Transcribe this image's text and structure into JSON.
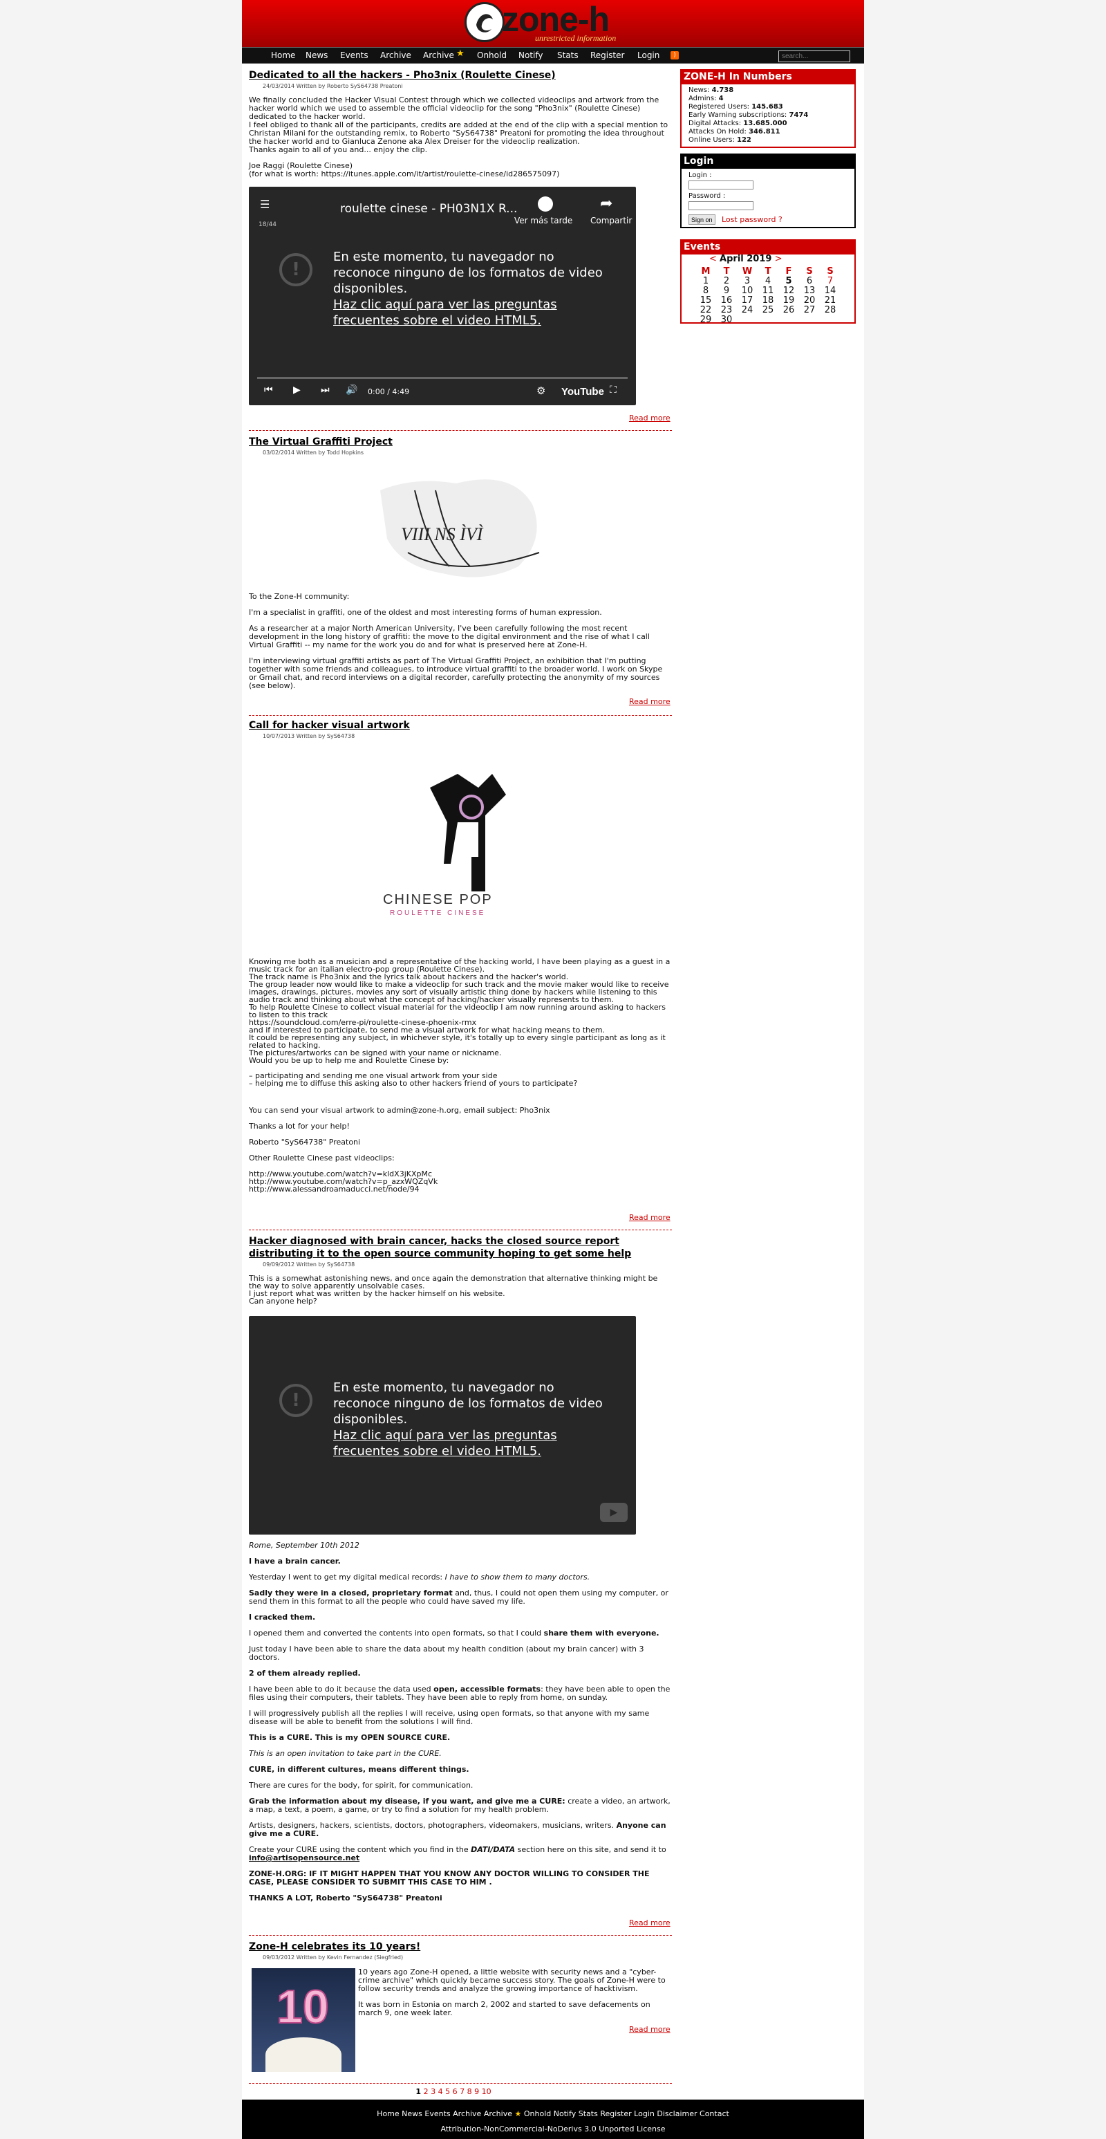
{
  "site": {
    "logo_text": "zone-h",
    "logo_subtitle": "unrestricted information"
  },
  "nav": [
    {
      "label": "Home"
    },
    {
      "label": "News"
    },
    {
      "label": "Events"
    },
    {
      "label": "Archive"
    },
    {
      "label": "Archive"
    },
    {
      "label": "Onhold"
    },
    {
      "label": "Notify"
    },
    {
      "label": "Stats"
    },
    {
      "label": "Register"
    },
    {
      "label": "Login"
    }
  ],
  "search": {
    "placeholder": "search..."
  },
  "articles": [
    {
      "title": "Dedicated to all the hackers - Pho3nix (Roulette Cinese)",
      "meta": "24/03/2014 Written by Roberto SyS64738 Preatoni",
      "p1": "We finally concluded the Hacker Visual Contest through which we collected videoclips and artwork from the hacker world which we used to assemble the official videoclip for the song \"Pho3nix\" (Roulette Cinese) dedicated to the hacker world.",
      "p2": "I feel obliged to thank all of the participants, credits are added at the end of the clip with a special mention to Christan Milani for the outstanding remix, to Roberto \"SyS64738\" Preatoni for promoting the idea throughout the hacker world and to Gianluca Zenone aka Alex Dreiser for the videoclip realization.",
      "p3": "Thanks again to all of you and... enjoy the clip.",
      "p4": "Joe Raggi (Roulette Cinese)",
      "p5": "(for what is worth: https://itunes.apple.com/it/artist/roulette-cinese/id286575097)",
      "video": {
        "title": "roulette cinese - PH03N1X R...",
        "counter": "18/44",
        "watch_later": "Ver más tarde",
        "share": "Compartir",
        "msg1": "En este momento, tu navegador no reconoce ninguno de los formatos de video disponibles.",
        "msg2": "Haz clic aquí para ver las preguntas frecuentes sobre el video HTML5.",
        "time": "0:00 / 4:49",
        "brand": "YouTube"
      }
    },
    {
      "title": "The Virtual Graffiti Project",
      "meta": "03/02/2014 Written by Todd Hopkins",
      "p1": "To the Zone-H community:",
      "p2": "I'm a specialist in graffiti, one of the oldest and most interesting forms of human expression.",
      "p3": "As a researcher at a major North American University, I've been carefully following the most recent development in the long history of graffiti: the move to the digital environment and the rise of what I call Virtual Graffiti -- my name for the work you do and for what is preserved here at Zone-H.",
      "p4": "I'm interviewing virtual graffiti artists as part of The Virtual Graffiti Project, an exhibition that I'm putting together with some friends and colleagues, to introduce virtual graffiti to the broader world. I work on Skype or Gmail chat, and record interviews on a digital recorder, carefully protecting the anonymity of my sources (see below).",
      "graffiti_text": "VIII NS ÌVÌ"
    },
    {
      "title": "Call for hacker visual artwork",
      "meta": "10/07/2013 Written by SyS64738",
      "logo_top": "CHINESE POP",
      "logo_bottom": "ROULETTE CINESE",
      "lines": [
        "Knowing me both as a musician and a representative of the hacking world, I have been playing as a guest in a music track for an italian electro-pop group (Roulette Cinese).",
        "The track name is Pho3nix and the lyrics talk about hackers and the hacker's world.",
        "The group leader now would like to make a videoclip for such track and the movie maker would like to receive images, drawings, pictures, movies any sort of visually artistic thing done by hackers while listening to this audio track and thinking about what the concept of hacking/hacker visually represents to them.",
        "To help Roulette Cinese to collect visual material for the videoclip I am now running around asking to hackers to listen to this track",
        "https://soundcloud.com/erre-pi/roulette-cinese-phoenix-rmx",
        "and if interested to participate, to send me a visual artwork for what hacking means to them.",
        "It could be representing any subject, in whichever style, it's totally up to every single participant as long as it related to hacking.",
        "The pictures/artworks can be signed with your name or nickname.",
        "Would you be up to help me and Roulette Cinese by:"
      ],
      "bullets": [
        "– participating and sending me one visual artwork from your side",
        "– helping me to diffuse this asking also to other hackers friend of yours to participate?"
      ],
      "send": "You can send your visual artwork to admin@zone-h.org, email subject: Pho3nix",
      "thanks": "Thanks a lot for your help!",
      "sig": "Roberto \"SyS64738\" Preatoni",
      "other": "Other Roulette Cinese past videoclips:",
      "links": [
        "http://www.youtube.com/watch?v=kldX3jKXpMc",
        "http://www.youtube.com/watch?v=p_azxWQZqVk",
        "http://www.alessandroamaducci.net/node/94"
      ]
    },
    {
      "title": "Hacker diagnosed with brain cancer, hacks the closed source report distributing it to the open source community hoping to get some help",
      "meta": "09/09/2012 Written by SyS64738",
      "intro": [
        "This is a somewhat astonishing news, and once again the demonstration that alternative thinking might be the way to solve apparently unsolvable cases.",
        "I just report what was written by the hacker himself on his website.",
        "Can anyone help?"
      ],
      "video": {
        "msg1": "En este momento, tu navegador no reconoce ninguno de los formatos de video disponibles.",
        "msg2": "Haz clic aquí para ver las preguntas frecuentes sobre el video HTML5."
      },
      "date": "Rome, September 10th 2012",
      "p1": "I have a brain cancer.",
      "p2a": "Yesterday I went to get my digital medical records: ",
      "p2b": "I have to show them to many doctors.",
      "p3a": "Sadly they were in a closed, proprietary format",
      "p3b": " and, thus, I could not open them using my computer, or send them in this format to all the people who could have saved my life.",
      "p4": "I cracked them.",
      "p5a": "I opened them and converted the contents into open formats, so that I could ",
      "p5b": "share them with everyone.",
      "p6": "Just today I have been able to share the data about my health condition (about my brain cancer) with 3 doctors.",
      "p7": "2 of them already replied.",
      "p8a": "I have been able to do it because the data used ",
      "p8b": "open, accessible formats",
      "p8c": ": they have been able to open the files using their computers, their tablets. They have been able to reply from home, on sunday.",
      "p9": "I will progressively publish all the replies I will receive, using open formats, so that anyone with my same disease will be able to benefit from the solutions I will find.",
      "p10": "This is a CURE. This is my OPEN SOURCE CURE.",
      "p11": "This is an open invitation to take part in the CURE.",
      "p12": "CURE, in different cultures, means different things.",
      "p13": "There are cures for the body, for spirit, for communication.",
      "p14a": "Grab the information about my disease, if you want, and give me a CURE:",
      "p14b": " create a video, an artwork, a map, a text, a poem, a game, or try to find a solution for my health problem.",
      "p15a": "Artists, designers, hackers, scientists, doctors, photographers, videomakers, musicians, writers. ",
      "p15b": "Anyone can give me a CURE.",
      "p16a": "Create your CURE using the content which you find in the ",
      "p16b": "DATI/DATA",
      "p16c": " section here on this site, and send it to ",
      "p16d": "info@artisopensource.net",
      "p17": "ZONE-H.ORG: IF IT MIGHT HAPPEN THAT YOU KNOW ANY DOCTOR WILLING TO CONSIDER THE CASE, PLEASE CONSIDER TO SUBMIT THIS CASE TO HIM .",
      "p18": "THANKS A LOT, Roberto \"SyS64738\" Preatoni"
    },
    {
      "title": "Zone-H celebrates its 10 years!",
      "meta": "09/03/2012 Written by Kevin Fernandez (Siegfried)",
      "p1": "10 years ago Zone-H opened, a little website with security news and a \"cyber-crime archive\" which quickly became success story. The goals of Zone-H were to follow security trends and analyze the growing importance of hacktivism.",
      "p2": "It was born in Estonia on march 2, 2002 and started to save defacements on march 9, one week later.",
      "cake_number": "10"
    }
  ],
  "read_more": "Read more",
  "sidebar": {
    "numbers": {
      "title": "ZONE-H In Numbers",
      "rows": [
        {
          "label": "News: ",
          "value": "4.738"
        },
        {
          "label": "Admins: ",
          "value": "4"
        },
        {
          "label": "Registered Users: ",
          "value": "145.683"
        },
        {
          "label": "Early Warning subscriptions: ",
          "value": "7474"
        },
        {
          "label": "Digital Attacks: ",
          "value": "13.685.000"
        },
        {
          "label": "Attacks On Hold: ",
          "value": "346.811"
        },
        {
          "label": "Online Users: ",
          "value": "122"
        }
      ]
    },
    "login": {
      "title": "Login",
      "login_label": "Login :",
      "password_label": "Password :",
      "button": "Sign on",
      "lost": "Lost password ?"
    },
    "events": {
      "title": "Events",
      "month": "April 2019",
      "prev": "<",
      "next": ">",
      "days": [
        "M",
        "T",
        "W",
        "T",
        "F",
        "S",
        "S"
      ],
      "weeks": [
        [
          "",
          "1",
          "2",
          "3",
          "4",
          "5",
          "6",
          "7"
        ],
        [
          "8",
          "9",
          "10",
          "11",
          "12",
          "13",
          "14"
        ],
        [
          "15",
          "16",
          "17",
          "18",
          "19",
          "20",
          "21"
        ],
        [
          "22",
          "23",
          "24",
          "25",
          "26",
          "27",
          "28"
        ],
        [
          "29",
          "30",
          "",
          "",
          "",
          "",
          ""
        ]
      ]
    }
  },
  "pager": {
    "current": "1",
    "pages": [
      "2",
      "3",
      "4",
      "5",
      "6",
      "7",
      "8",
      "9",
      "10"
    ]
  },
  "footer": {
    "links": [
      "Home",
      "News",
      "Events",
      "Archive",
      "Archive",
      "Onhold",
      "Notify",
      "Stats",
      "Register",
      "Login",
      "Disclaimer",
      "Contact"
    ],
    "license": "Attribution-NonCommercial-NoDerivs 3.0 Unported License"
  },
  "colors": {
    "brand_red": "#cc0000",
    "header_black": "#111111"
  }
}
